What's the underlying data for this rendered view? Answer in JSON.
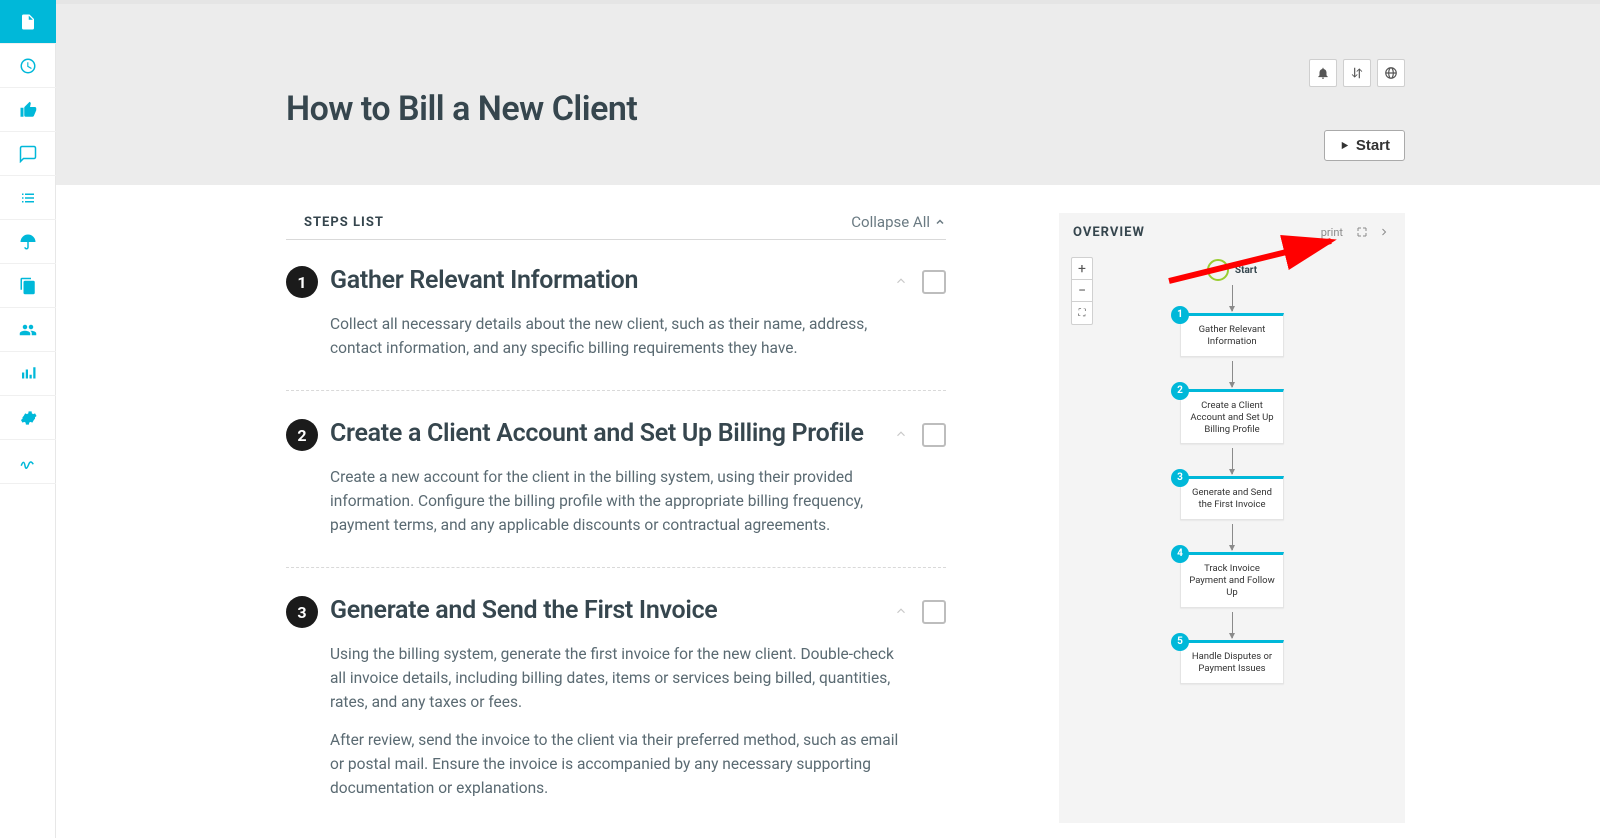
{
  "sidebar": {
    "items": [
      {
        "name": "document-icon"
      },
      {
        "name": "clock-icon"
      },
      {
        "name": "thumbs-up-icon"
      },
      {
        "name": "chat-icon"
      },
      {
        "name": "list-icon"
      },
      {
        "name": "umbrella-icon"
      },
      {
        "name": "copy-icon"
      },
      {
        "name": "users-icon"
      },
      {
        "name": "stats-icon"
      },
      {
        "name": "gear-icon"
      },
      {
        "name": "signature-icon"
      }
    ]
  },
  "header": {
    "title": "How to Bill a New Client",
    "start_label": "Start"
  },
  "steps_list": {
    "heading": "STEPS LIST",
    "collapse_label": "Collapse All",
    "steps": [
      {
        "number": "1",
        "title": "Gather Relevant Information",
        "paragraphs": [
          "Collect all necessary details about the new client, such as their name, address, contact information, and any specific billing requirements they have."
        ]
      },
      {
        "number": "2",
        "title": "Create a Client Account and Set Up Billing Profile",
        "paragraphs": [
          "Create a new account for the client in the billing system, using their provided information. Configure the billing profile with the appropriate billing frequency, payment terms, and any applicable discounts or contractual agreements."
        ]
      },
      {
        "number": "3",
        "title": "Generate and Send the First Invoice",
        "paragraphs": [
          "Using the billing system, generate the first invoice for the new client. Double-check all invoice details, including billing dates, items or services being billed, quantities, rates, and any taxes or fees.",
          "After review, send the invoice to the client via their preferred method, such as email or postal mail. Ensure the invoice is accompanied by any necessary supporting documentation or explanations."
        ]
      }
    ]
  },
  "overview": {
    "heading": "OVERVIEW",
    "print_label": "print",
    "start_label": "Start",
    "nodes": [
      {
        "n": "1",
        "label": "Gather Relevant Information"
      },
      {
        "n": "2",
        "label": "Create a Client Account and Set Up Billing Profile"
      },
      {
        "n": "3",
        "label": "Generate and Send the First Invoice"
      },
      {
        "n": "4",
        "label": "Track Invoice Payment and Follow Up"
      },
      {
        "n": "5",
        "label": "Handle Disputes or Payment Issues"
      }
    ]
  }
}
